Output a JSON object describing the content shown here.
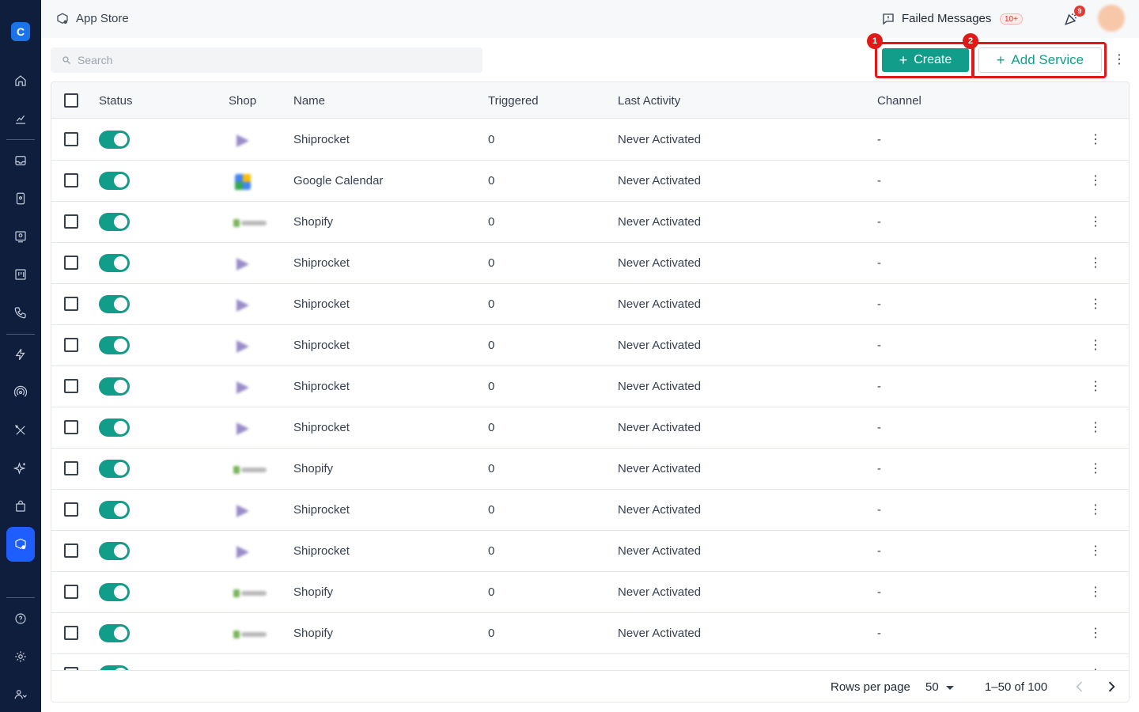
{
  "header": {
    "app_title": "App Store",
    "failed_messages_label": "Failed Messages",
    "failed_messages_badge": "10+",
    "notification_count": "9"
  },
  "search": {
    "placeholder": "Search",
    "value": ""
  },
  "toolbar": {
    "create_label": "Create",
    "add_service_label": "Add Service",
    "annotation_1": "1",
    "annotation_2": "2"
  },
  "table": {
    "columns": [
      "Status",
      "Shop",
      "Name",
      "Triggered",
      "Last Activity",
      "Channel"
    ],
    "rows": [
      {
        "enabled": true,
        "shop_icon": "shiprocket-logo",
        "name": "Shiprocket",
        "triggered": "0",
        "last_activity": "Never Activated",
        "channel": "-"
      },
      {
        "enabled": true,
        "shop_icon": "google-calendar-logo",
        "name": "Google Calendar",
        "triggered": "0",
        "last_activity": "Never Activated",
        "channel": "-"
      },
      {
        "enabled": true,
        "shop_icon": "shopify-logo",
        "name": "Shopify",
        "triggered": "0",
        "last_activity": "Never Activated",
        "channel": "-"
      },
      {
        "enabled": true,
        "shop_icon": "shiprocket-logo",
        "name": "Shiprocket",
        "triggered": "0",
        "last_activity": "Never Activated",
        "channel": "-"
      },
      {
        "enabled": true,
        "shop_icon": "shiprocket-logo",
        "name": "Shiprocket",
        "triggered": "0",
        "last_activity": "Never Activated",
        "channel": "-"
      },
      {
        "enabled": true,
        "shop_icon": "shiprocket-logo",
        "name": "Shiprocket",
        "triggered": "0",
        "last_activity": "Never Activated",
        "channel": "-"
      },
      {
        "enabled": true,
        "shop_icon": "shiprocket-logo",
        "name": "Shiprocket",
        "triggered": "0",
        "last_activity": "Never Activated",
        "channel": "-"
      },
      {
        "enabled": true,
        "shop_icon": "shiprocket-logo",
        "name": "Shiprocket",
        "triggered": "0",
        "last_activity": "Never Activated",
        "channel": "-"
      },
      {
        "enabled": true,
        "shop_icon": "shopify-logo",
        "name": "Shopify",
        "triggered": "0",
        "last_activity": "Never Activated",
        "channel": "-"
      },
      {
        "enabled": true,
        "shop_icon": "shiprocket-logo",
        "name": "Shiprocket",
        "triggered": "0",
        "last_activity": "Never Activated",
        "channel": "-"
      },
      {
        "enabled": true,
        "shop_icon": "shiprocket-logo",
        "name": "Shiprocket",
        "triggered": "0",
        "last_activity": "Never Activated",
        "channel": "-"
      },
      {
        "enabled": true,
        "shop_icon": "shopify-logo",
        "name": "Shopify",
        "triggered": "0",
        "last_activity": "Never Activated",
        "channel": "-"
      },
      {
        "enabled": true,
        "shop_icon": "shopify-logo",
        "name": "Shopify",
        "triggered": "0",
        "last_activity": "Never Activated",
        "channel": "-"
      },
      {
        "enabled": true,
        "shop_icon": "shopify-logo",
        "name": "",
        "triggered": "",
        "last_activity": "",
        "channel": ""
      }
    ]
  },
  "pagination": {
    "rows_per_page_label": "Rows per page",
    "rows_per_page_value": "50",
    "range": "1–50 of 100"
  },
  "colors": {
    "accent": "#129d8a",
    "sidebar": "#0f1e3d",
    "active_nav": "#1e5eff",
    "highlight": "#e01818"
  },
  "sidebar": {
    "icons": [
      "home-icon",
      "analytics-icon",
      "inbox-icon",
      "contacts-icon",
      "campaigns-icon",
      "board-icon",
      "phone-icon",
      "automation-icon",
      "broadcast-icon",
      "tools-icon",
      "ai-icon",
      "commerce-icon",
      "app-store-icon",
      "help-icon",
      "settings-icon",
      "team-icon"
    ]
  }
}
